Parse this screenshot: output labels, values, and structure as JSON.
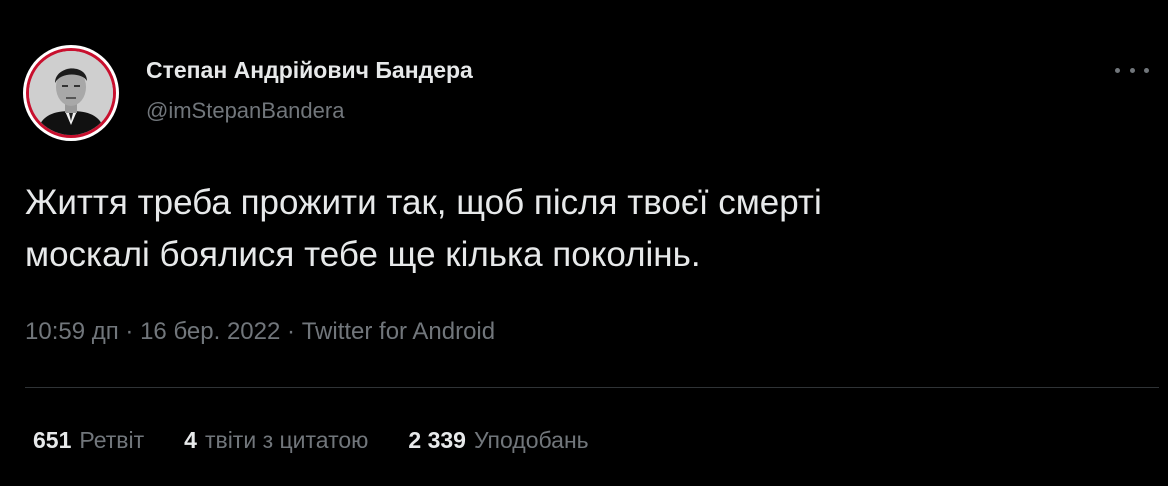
{
  "colors": {
    "background": "#000000",
    "text_primary": "#e7e9ea",
    "text_secondary": "#71767b",
    "divider": "#2f3336",
    "avatar_ring": "#c8102e"
  },
  "author": {
    "display_name": "Степан Андрійович Бандера",
    "handle": "@imStepanBandera",
    "avatar_icon": "profile-photo"
  },
  "menu": {
    "icon": "more-horizontal-icon"
  },
  "tweet": {
    "lines": [
      "Життя треба прожити так, щоб після твоєї смерті",
      "москалі боялися тебе ще кілька поколінь."
    ],
    "time": "10:59 дп",
    "separator": "·",
    "date": "16 бер. 2022",
    "source": "Twitter for Android"
  },
  "stats": {
    "retweets": {
      "count": "651",
      "label": "Ретвіт"
    },
    "quotes": {
      "count": "4",
      "label": "твіти з цитатою"
    },
    "likes": {
      "count": "2 339",
      "label": "Уподобань"
    }
  }
}
